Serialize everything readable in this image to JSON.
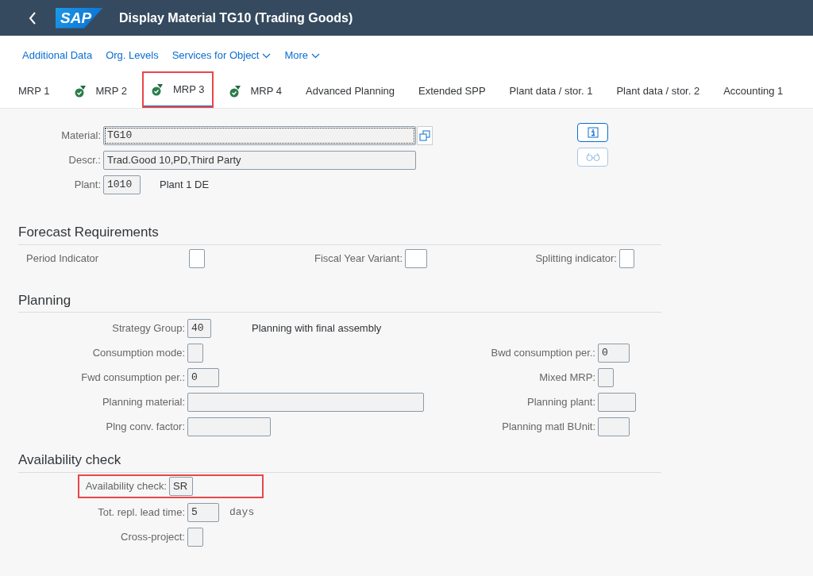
{
  "header": {
    "logo": "SAP",
    "title": "Display Material TG10 (Trading Goods)"
  },
  "toolbar": [
    {
      "label": "Additional Data",
      "dropdown": false
    },
    {
      "label": "Org. Levels",
      "dropdown": false
    },
    {
      "label": "Services for Object",
      "dropdown": true
    },
    {
      "label": "More",
      "dropdown": true
    }
  ],
  "tabs": [
    {
      "label": "MRP 1",
      "icon": false,
      "selected": false,
      "highlighted": false
    },
    {
      "label": "MRP 2",
      "icon": true,
      "selected": false,
      "highlighted": false
    },
    {
      "label": "MRP 3",
      "icon": true,
      "selected": true,
      "highlighted": true
    },
    {
      "label": "MRP 4",
      "icon": true,
      "selected": false,
      "highlighted": false
    },
    {
      "label": "Advanced Planning",
      "icon": false,
      "selected": false,
      "highlighted": false
    },
    {
      "label": "Extended SPP",
      "icon": false,
      "selected": false,
      "highlighted": false
    },
    {
      "label": "Plant data / stor. 1",
      "icon": false,
      "selected": false,
      "highlighted": false
    },
    {
      "label": "Plant data / stor. 2",
      "icon": false,
      "selected": false,
      "highlighted": false
    },
    {
      "label": "Accounting 1",
      "icon": false,
      "selected": false,
      "highlighted": false
    }
  ],
  "object_header": {
    "material": {
      "label": "Material:",
      "value": "TG10"
    },
    "description": {
      "label": "Descr.:",
      "value": "Trad.Good 10,PD,Third Party"
    },
    "plant": {
      "label": "Plant:",
      "value": "1010",
      "text": "Plant 1 DE"
    }
  },
  "sections": [
    {
      "title": "Forecast Requirements",
      "kind": "inline",
      "fields": [
        {
          "label": "Period Indicator"
        },
        {
          "label": "Fiscal Year Variant:"
        },
        {
          "label": "Splitting indicator:"
        }
      ]
    },
    {
      "title": "Planning",
      "kind": "form",
      "rows": [
        {
          "left": {
            "label": "Strategy Group:",
            "value": "40",
            "text": "Planning with final assembly"
          }
        },
        {
          "left": {
            "label": "Consumption mode:"
          },
          "right": {
            "label": "Bwd consumption per.:",
            "value": "0"
          }
        },
        {
          "left": {
            "label": "Fwd consumption per.:",
            "value": "0"
          },
          "right": {
            "label": "Mixed MRP:"
          }
        },
        {
          "left": {
            "label": "Planning material:"
          },
          "right": {
            "label": "Planning plant:"
          }
        },
        {
          "left": {
            "label": "Plng conv. factor:"
          },
          "right": {
            "label": "Planning matl BUnit:"
          }
        }
      ]
    },
    {
      "title": "Availability check",
      "kind": "form",
      "rows": [
        {
          "left": {
            "label": "Availability check:",
            "value": "SR"
          },
          "highlighted": true
        },
        {
          "left": {
            "label": "Tot. repl. lead time:",
            "value": "5",
            "unit": "days"
          },
          "highlighted": false
        },
        {
          "left": {
            "label": "Cross-project:"
          },
          "highlighted": false
        }
      ]
    }
  ]
}
